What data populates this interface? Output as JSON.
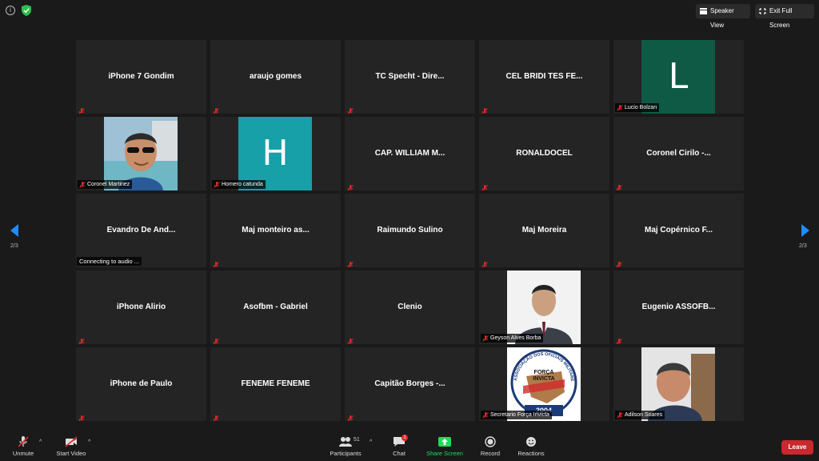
{
  "topbar": {
    "info_icon": "info-icon",
    "shield_icon": "shield-icon",
    "speaker_view_label": "Speaker View",
    "exit_fullscreen_label": "Exit Full Screen"
  },
  "navigation": {
    "left_page": "2/3",
    "right_page": "2/3"
  },
  "tiles": [
    {
      "display_name": "iPhone 7 Gondim"
    },
    {
      "display_name": "araujo gomes"
    },
    {
      "display_name": "TC Specht - Dire..."
    },
    {
      "display_name": "CEL BRIDI TES FE..."
    },
    {
      "avatar_letter": "L",
      "avatar_color": "#0e5a44",
      "label": "Lucio Bolzan"
    },
    {
      "video": "man with sunglasses",
      "label": "Coronel Martinez"
    },
    {
      "avatar_letter": "H",
      "avatar_color": "#17a0a8",
      "label": "Homero catunda"
    },
    {
      "display_name": "CAP. WILLIAM M..."
    },
    {
      "display_name": "RONALDOCEL"
    },
    {
      "display_name": "Coronel Cirilo -..."
    },
    {
      "display_name": "Evandro De And...",
      "status": "Connecting to audio ..."
    },
    {
      "display_name": "Maj monteiro as..."
    },
    {
      "display_name": "Raimundo Sulino"
    },
    {
      "display_name": "Maj Moreira"
    },
    {
      "display_name": "Maj Copérnico F..."
    },
    {
      "display_name": "iPhone Alirio"
    },
    {
      "display_name": "Asofbm - Gabriel"
    },
    {
      "display_name": "Clenio"
    },
    {
      "video": "man in suit",
      "label": "Geyson Alves Borba"
    },
    {
      "display_name": "Eugenio ASSOFB..."
    },
    {
      "display_name": "iPhone de Paulo"
    },
    {
      "display_name": "FENEME FENEME"
    },
    {
      "display_name": "Capitão Borges -..."
    },
    {
      "video": "association seal",
      "label": "Secretario Força Invicta",
      "seal_text": [
        "ASSOCIAÇÃO DOS OFICIAIS MILITARES ESTADUAIS DA BAHIA",
        "FORÇA",
        "INVICTA",
        "2004"
      ]
    },
    {
      "video": "older man",
      "label": "Adilson Soares"
    }
  ],
  "bottombar": {
    "unmute_label": "Unmute",
    "start_video_label": "Start Video",
    "participants_label": "Participants",
    "participants_count": "51",
    "chat_label": "Chat",
    "chat_badge": "1",
    "share_screen_label": "Share Screen",
    "record_label": "Record",
    "reactions_label": "Reactions",
    "leave_label": "Leave",
    "share_color": "#23d959",
    "leave_color": "#c8282e"
  }
}
